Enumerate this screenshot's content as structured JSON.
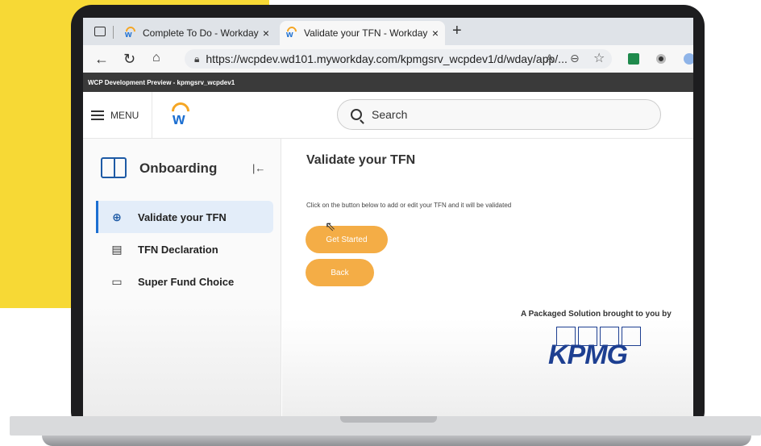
{
  "browser": {
    "tabs": [
      {
        "label": "Complete To Do - Workday"
      },
      {
        "label": "Validate your TFN - Workday"
      }
    ],
    "url": "https://wcpdev.wd101.myworkday.com/kpmgsrv_wcpdev1/d/wday/app/...",
    "new_tab_symbol": "+",
    "close_symbol": "×"
  },
  "dev_banner": "WCP Development Preview - kpmgsrv_wcpdev1",
  "header": {
    "menu_label": "MENU",
    "search_placeholder": "Search"
  },
  "sidebar": {
    "title": "Onboarding",
    "collapse_symbol": "|←",
    "items": [
      {
        "label": "Validate your TFN",
        "icon": "globe-icon",
        "active": true
      },
      {
        "label": "TFN Declaration",
        "icon": "document-icon",
        "active": false
      },
      {
        "label": "Super Fund Choice",
        "icon": "folder-icon",
        "active": false
      }
    ]
  },
  "main": {
    "title": "Validate your TFN",
    "instructions": "Click on the button below to add or edit your TFN and it will be validated",
    "get_started_label": "Get Started",
    "back_label": "Back",
    "packaged_text": "A Packaged Solution brought to you by",
    "kpmg_logo_text": "KPMG"
  },
  "colors": {
    "accent_button": "#f4ad46",
    "workday_blue": "#1d6fd1",
    "workday_orange": "#f5a623",
    "kpmg_blue": "#1d3f91",
    "background_yellow": "#f7d935"
  }
}
